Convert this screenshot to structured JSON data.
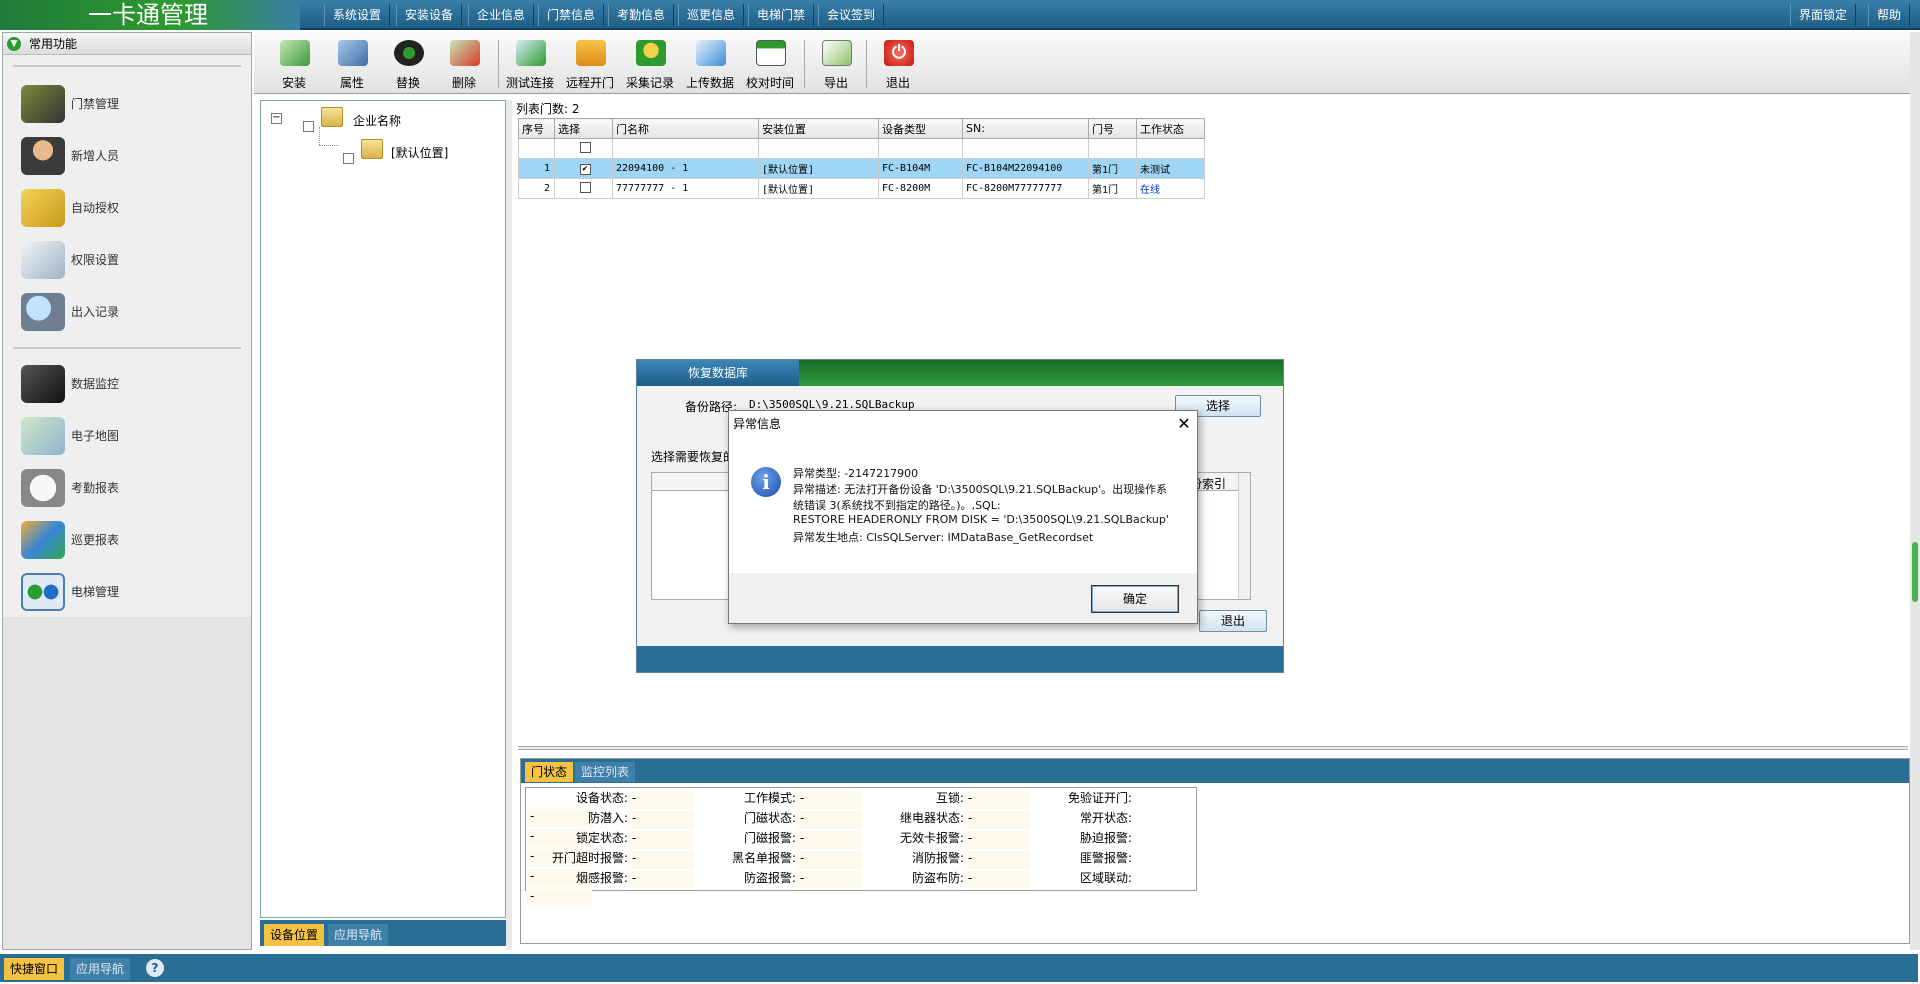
{
  "app": {
    "title": "一卡通管理"
  },
  "menu": [
    "系统设置",
    "安装设备",
    "企业信息",
    "门禁信息",
    "考勤信息",
    "巡更信息",
    "电梯门禁",
    "会议签到"
  ],
  "menu_right": [
    "界面锁定",
    "帮助"
  ],
  "left_panel": {
    "header": "常用功能",
    "items": [
      "门禁管理",
      "新增人员",
      "自动授权",
      "权限设置",
      "出入记录",
      "数据监控",
      "电子地图",
      "考勤报表",
      "巡更报表",
      "电梯管理"
    ],
    "bottom_tabs": [
      "快捷窗口",
      "应用导航"
    ],
    "help_icon": "?"
  },
  "toolbar": [
    "安装",
    "属性",
    "替换",
    "删除",
    "测试连接",
    "远程开门",
    "采集记录",
    "上传数据",
    "校对时间",
    "导出",
    "退出"
  ],
  "tree": {
    "root": "企业名称",
    "child": "[默认位置]",
    "bottom_tabs": [
      "设备位置",
      "应用导航"
    ]
  },
  "list": {
    "info": "列表门数: 2",
    "columns": [
      "序号",
      "选择",
      "门名称",
      "安装位置",
      "设备类型",
      "SN:",
      "门号",
      "工作状态"
    ],
    "rows": [
      {
        "no": "1",
        "checked": "✔",
        "name": "22094100 - 1",
        "location": "[默认位置]",
        "type": "FC-B104M",
        "sn": "FC-B104M22094100",
        "door": "第1门",
        "status": "未测试"
      },
      {
        "no": "2",
        "checked": "",
        "name": "77777777 - 1",
        "location": "[默认位置]",
        "type": "FC-8200M",
        "sn": "FC-8200M77777777",
        "door": "第1门",
        "status": "在线"
      }
    ]
  },
  "status_panel": {
    "tabs": [
      "门状态",
      "监控列表"
    ],
    "rows": [
      [
        [
          "设备状态:",
          "-"
        ],
        [
          "工作模式:",
          "-"
        ],
        [
          "互锁:",
          "-"
        ],
        [
          "免验证开门:",
          "-"
        ]
      ],
      [
        [
          "防潜入:",
          "-"
        ],
        [
          "门磁状态:",
          "-"
        ],
        [
          "继电器状态:",
          "-"
        ],
        [
          "常开状态:",
          "-"
        ]
      ],
      [
        [
          "锁定状态:",
          "-"
        ],
        [
          "门磁报警:",
          "-"
        ],
        [
          "无效卡报警:",
          "-"
        ],
        [
          "胁迫报警:",
          "-"
        ]
      ],
      [
        [
          "开门超时报警:",
          "-"
        ],
        [
          "黑名单报警:",
          "-"
        ],
        [
          "消防报警:",
          "-"
        ],
        [
          "匪警报警:",
          "-"
        ]
      ],
      [
        [
          "烟感报警:",
          "-"
        ],
        [
          "防盗报警:",
          "-"
        ],
        [
          "防盗布防:",
          "-"
        ],
        [
          "区域联动:",
          "-"
        ]
      ]
    ]
  },
  "restore_dialog": {
    "title": "恢复数据库",
    "path_label": "备份路径:",
    "path_value": "D:\\3500SQL\\9.21.SQLBackup",
    "choose_button": "选择",
    "select_label": "选择需要恢复的",
    "col_partial": "份索引",
    "exit_button": "退出"
  },
  "error_dialog": {
    "title": "异常信息",
    "lines": [
      "异常类型: -2147217900",
      "异常描述: 无法打开备份设备 'D:\\3500SQL\\9.21.SQLBackup'。出现操作系",
      "统错误 3(系统找不到指定的路径。)。,SQL:",
      "RESTORE HEADERONLY FROM DISK = 'D:\\3500SQL\\9.21.SQLBackup'",
      "异常发生地点: ClsSQLServer: IMDataBase_GetRecordset"
    ],
    "ok_button": "确定",
    "close_glyph": "✕"
  },
  "colors": {
    "accent_blue": "#2a6d95",
    "title_green": "#2d9b3a",
    "selected_row": "#9fd6f5",
    "online_status": "#0033cc",
    "active_tab": "#f5c242"
  }
}
